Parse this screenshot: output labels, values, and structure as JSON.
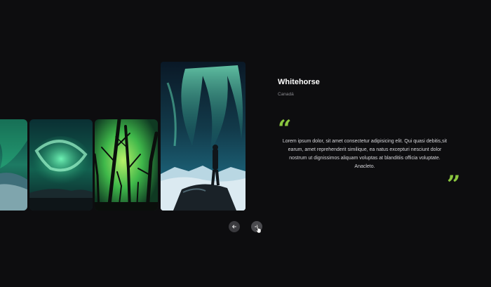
{
  "slide": {
    "title": "Whitehorse",
    "subtitle": "Canadá",
    "quote_open": "“",
    "quote_close": "”",
    "quote": "Lorem ipsum dolor, sit amet consectetur adipisicing elit. Qui quasi debitis,sit earum, amet reprehenderit similique, ea natus excepturi nesciunt dolor nostrum ut dignissimos aliquam voluptas at blanditiis officia voluptate. Anacleto."
  },
  "gallery": {
    "cards": [
      {
        "name": "aurora-snow-landscape"
      },
      {
        "name": "aurora-swirl-lake"
      },
      {
        "name": "aurora-forest-trees"
      },
      {
        "name": "aurora-person-on-rock"
      }
    ]
  },
  "controls": {
    "prev_icon": "arrow-left-icon",
    "next_icon": "arrow-right-icon"
  },
  "colors": {
    "background": "#0d0d0f",
    "accent": "#8bc63f",
    "button": "#3a3a3e"
  }
}
